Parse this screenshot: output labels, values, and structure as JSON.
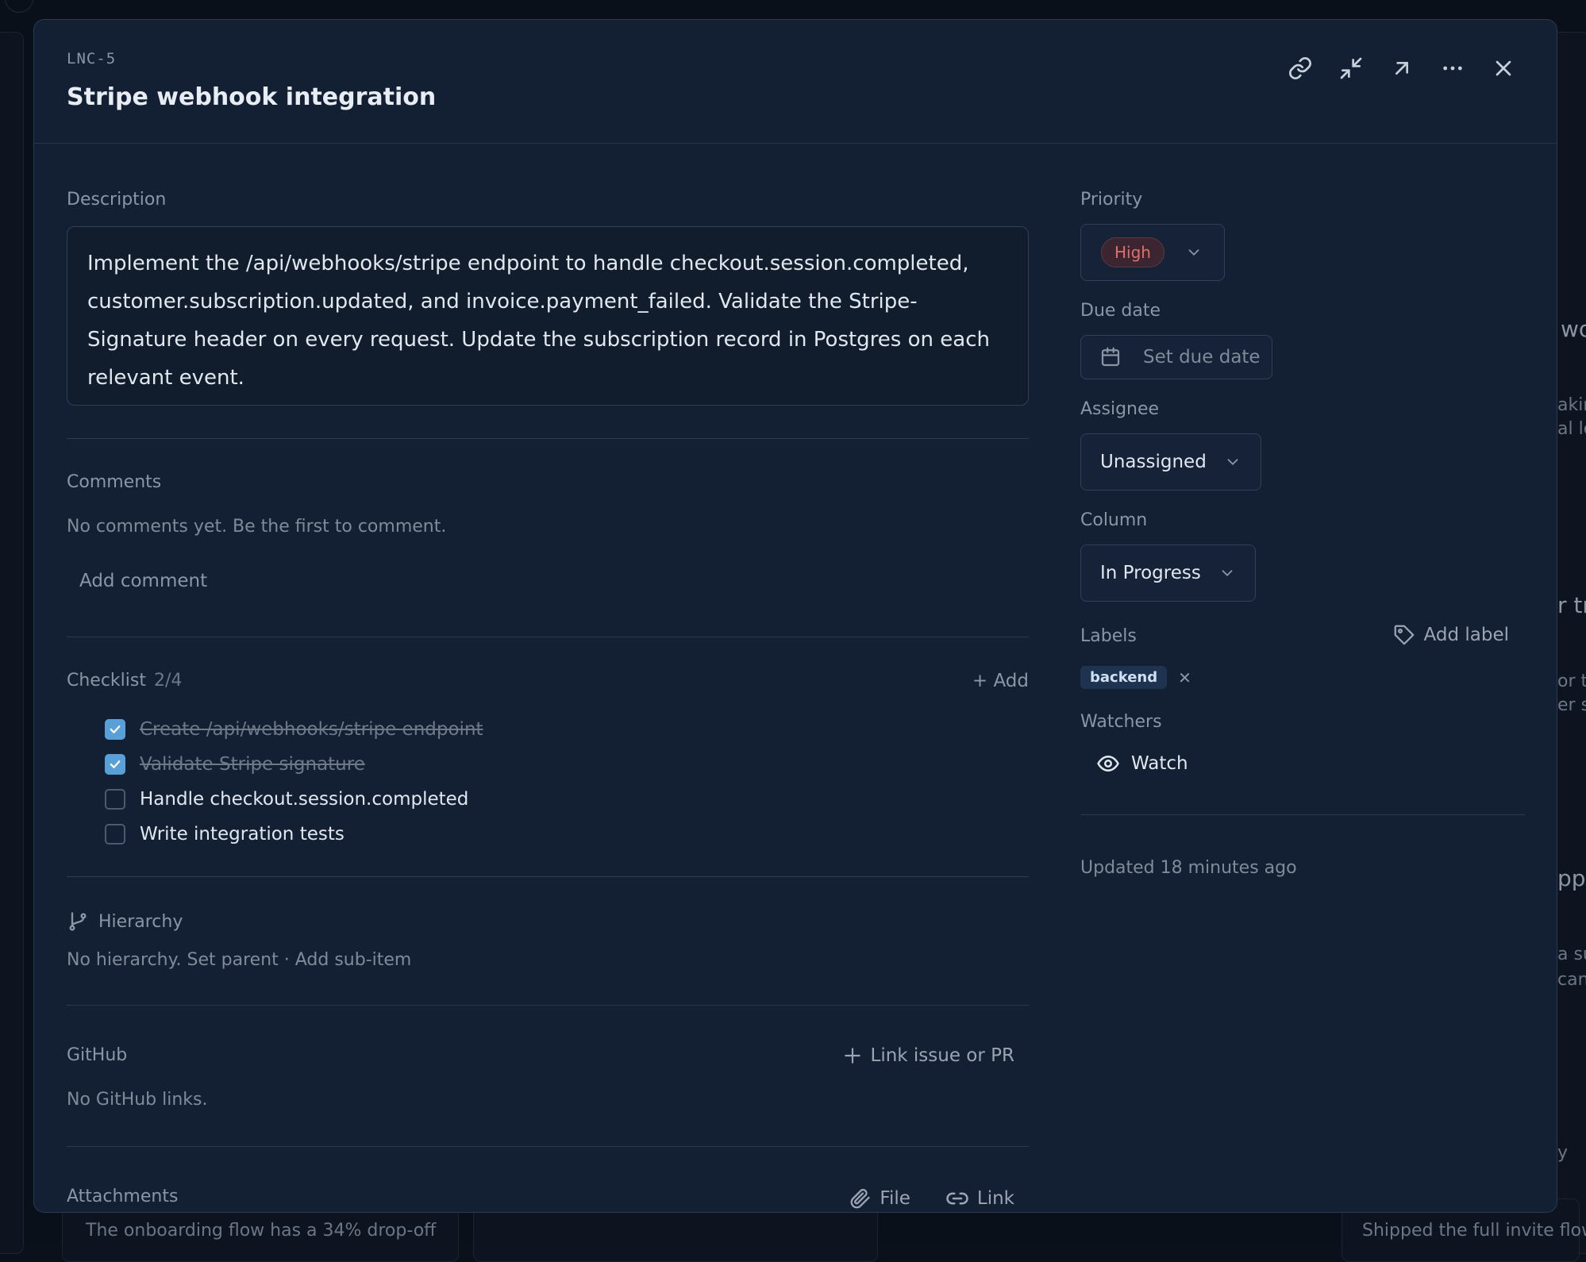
{
  "background": {
    "peek_texts": [
      "wo",
      "akin",
      "al lo",
      "r tr",
      "or t",
      "er s",
      "pp",
      "a su",
      "can",
      "y"
    ],
    "footer_left": "The onboarding flow has a 34% drop-off",
    "footer_right": "Shipped the full invite flow:"
  },
  "issue": {
    "key": "LNC-5",
    "title": "Stripe webhook integration"
  },
  "description": {
    "label": "Description",
    "text": "Implement the /api/webhooks/stripe endpoint to handle checkout.session.completed, customer.subscription.updated, and invoice.payment_failed. Validate the Stripe-Signature header on every request. Update the subscription record in Postgres on each relevant event."
  },
  "comments": {
    "label": "Comments",
    "empty": "No comments yet. Be the first to comment.",
    "add": "Add comment"
  },
  "checklist": {
    "label": "Checklist",
    "count": "2/4",
    "add": "+ Add",
    "items": [
      {
        "text": "Create /api/webhooks/stripe endpoint",
        "done": true
      },
      {
        "text": "Validate Stripe signature",
        "done": true
      },
      {
        "text": "Handle checkout.session.completed",
        "done": false
      },
      {
        "text": "Write integration tests",
        "done": false
      }
    ]
  },
  "hierarchy": {
    "label": "Hierarchy",
    "empty_prefix": "No hierarchy.",
    "set_parent": "Set parent",
    "sep": "·",
    "add_sub": "Add sub-item"
  },
  "github": {
    "label": "GitHub",
    "link": "Link issue or PR",
    "empty": "No GitHub links."
  },
  "attachments": {
    "label": "Attachments",
    "file": "File",
    "link": "Link"
  },
  "sidebar": {
    "priority": {
      "label": "Priority",
      "value": "High",
      "color": "#e0706c"
    },
    "due_date": {
      "label": "Due date",
      "placeholder": "Set due date"
    },
    "assignee": {
      "label": "Assignee",
      "value": "Unassigned"
    },
    "column": {
      "label": "Column",
      "value": "In Progress"
    },
    "labels": {
      "label": "Labels",
      "add": "Add label",
      "items": [
        "backend"
      ]
    },
    "watchers": {
      "label": "Watchers",
      "watch": "Watch"
    },
    "updated": "Updated 18 minutes ago"
  },
  "colors": {
    "modal_bg": "#132034",
    "accent": "#5aa0d8",
    "label_chip": "#1e3350"
  }
}
